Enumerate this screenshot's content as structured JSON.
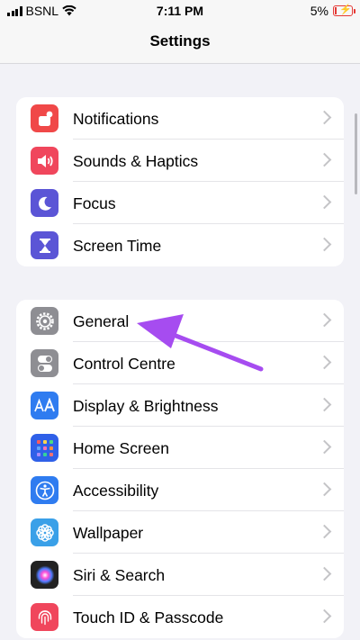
{
  "status_bar": {
    "carrier": "BSNL",
    "time": "7:11 PM",
    "battery_percent": "5%",
    "battery_level": 0.05,
    "battery_color": "#e53935"
  },
  "nav": {
    "title": "Settings"
  },
  "groups": [
    {
      "items": [
        {
          "label": "Notifications",
          "icon": "notifications-icon",
          "color": "#f04848"
        },
        {
          "label": "Sounds & Haptics",
          "icon": "speaker-icon",
          "color": "#f0465c"
        },
        {
          "label": "Focus",
          "icon": "moon-icon",
          "color": "#5b55d6"
        },
        {
          "label": "Screen Time",
          "icon": "hourglass-icon",
          "color": "#5b55d6"
        }
      ]
    },
    {
      "items": [
        {
          "label": "General",
          "icon": "gear-icon",
          "color": "#8e8e93"
        },
        {
          "label": "Control Centre",
          "icon": "toggles-icon",
          "color": "#8e8e93"
        },
        {
          "label": "Display & Brightness",
          "icon": "text-size-icon",
          "color": "#2f7cf0"
        },
        {
          "label": "Home Screen",
          "icon": "app-grid-icon",
          "color": "#2f60e8"
        },
        {
          "label": "Accessibility",
          "icon": "accessibility-icon",
          "color": "#2f7cf0"
        },
        {
          "label": "Wallpaper",
          "icon": "flower-icon",
          "color": "#3aa0e8"
        },
        {
          "label": "Siri & Search",
          "icon": "siri-icon",
          "color": "#222222"
        },
        {
          "label": "Touch ID & Passcode",
          "icon": "fingerprint-icon",
          "color": "#f0465c"
        }
      ]
    }
  ],
  "annotation": {
    "arrow_color": "#a64cf0",
    "points_to": "General"
  }
}
